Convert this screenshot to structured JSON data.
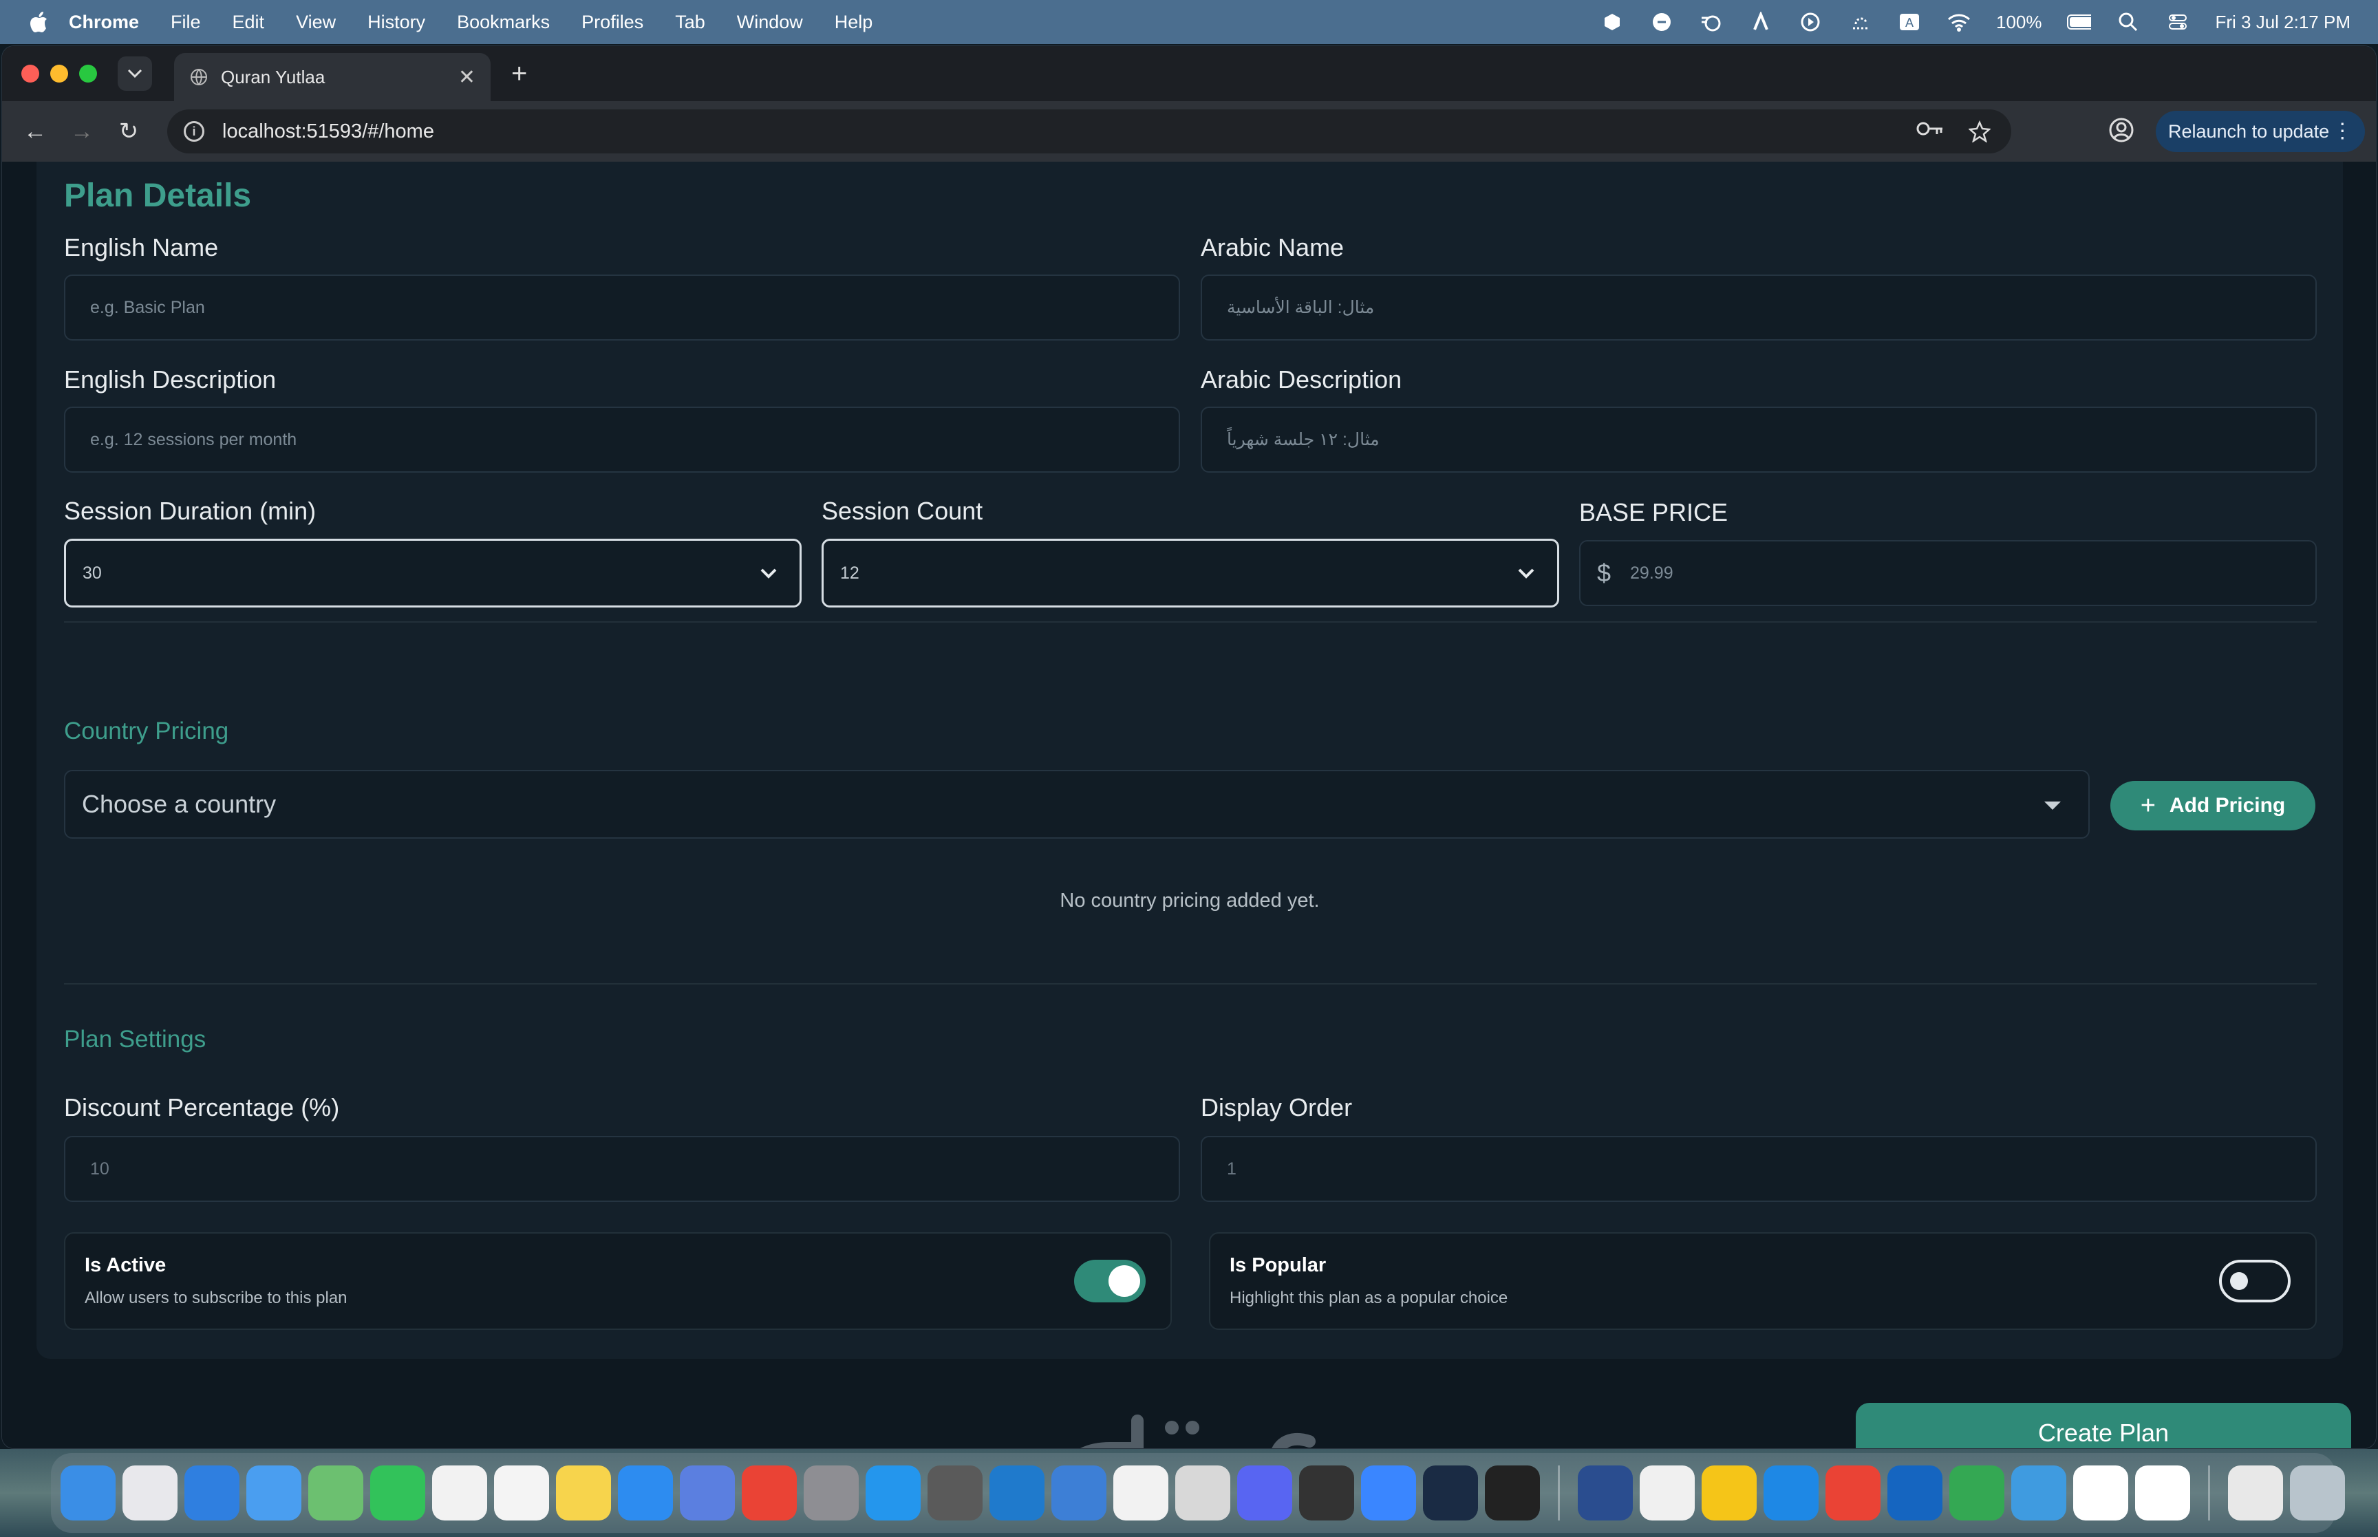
{
  "menubar": {
    "app_name": "Chrome",
    "items": [
      "File",
      "Edit",
      "View",
      "History",
      "Bookmarks",
      "Profiles",
      "Tab",
      "Window",
      "Help"
    ],
    "battery": "100%",
    "datetime": "Fri 3 Jul  2:17 PM"
  },
  "browser": {
    "tab_title": "Quran Yutlaa",
    "url": "localhost:51593/#/home",
    "relaunch_label": "Relaunch to update"
  },
  "plan_details": {
    "title": "Plan Details",
    "english_name_label": "English Name",
    "english_name_placeholder": "e.g. Basic Plan",
    "arabic_name_label": "Arabic Name",
    "arabic_name_placeholder": "مثال: الباقة الأساسية",
    "english_desc_label": "English Description",
    "english_desc_placeholder": "e.g. 12 sessions per month",
    "arabic_desc_label": "Arabic Description",
    "arabic_desc_placeholder": "مثال: ١٢ جلسة شهرياً",
    "session_duration_label": "Session Duration (min)",
    "session_duration_value": "30",
    "session_count_label": "Session Count",
    "session_count_value": "12",
    "base_price_label": "BASE PRICE",
    "currency_symbol": "$",
    "base_price_placeholder": "29.99"
  },
  "country_pricing": {
    "title": "Country Pricing",
    "select_placeholder": "Choose a country",
    "add_button": "Add Pricing",
    "empty_text": "No country pricing added yet."
  },
  "plan_settings": {
    "title": "Plan Settings",
    "discount_label": "Discount Percentage (%)",
    "discount_value": "10",
    "display_order_label": "Display Order",
    "display_order_value": "1",
    "is_active_title": "Is Active",
    "is_active_desc": "Allow users to subscribe to this plan",
    "is_active_on": true,
    "is_popular_title": "Is Popular",
    "is_popular_desc": "Highlight this plan as a popular choice",
    "is_popular_on": false
  },
  "create_button": "Create Plan",
  "colors": {
    "accent": "#2f8a78",
    "heading": "#3e9e8c",
    "card_bg": "#14202a",
    "page_bg": "#0e1820"
  }
}
